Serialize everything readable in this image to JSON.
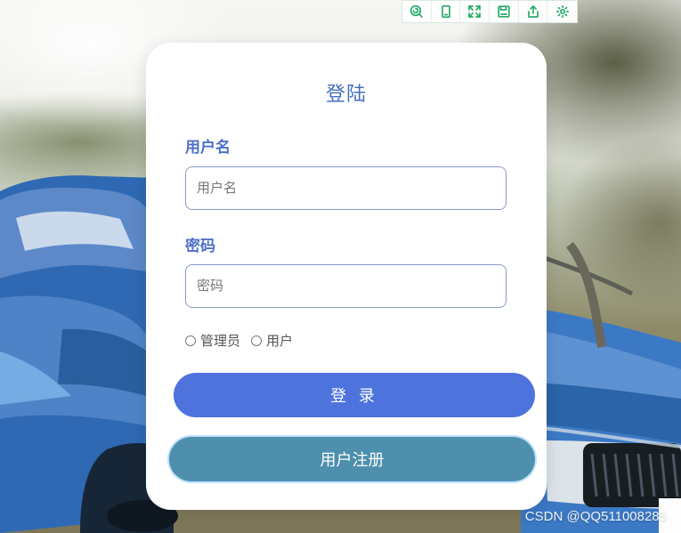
{
  "toolbar": {
    "icons": [
      "search-circle-icon",
      "device-icon",
      "fullscreen-icon",
      "save-icon",
      "share-icon",
      "settings-icon"
    ]
  },
  "form": {
    "title": "登陆",
    "username_label": "用户名",
    "username_placeholder": "用户名",
    "password_label": "密码",
    "password_placeholder": "密码",
    "roles": [
      {
        "label": "管理员"
      },
      {
        "label": "用户"
      }
    ],
    "login_button": "登 录",
    "register_button": "用户注册"
  },
  "watermark": "CSDN @QQ511008285",
  "colors": {
    "accent": "#4e73dd",
    "label": "#4e71c7",
    "register": "#4f8fae",
    "toolbar_icon": "#28ab67"
  }
}
